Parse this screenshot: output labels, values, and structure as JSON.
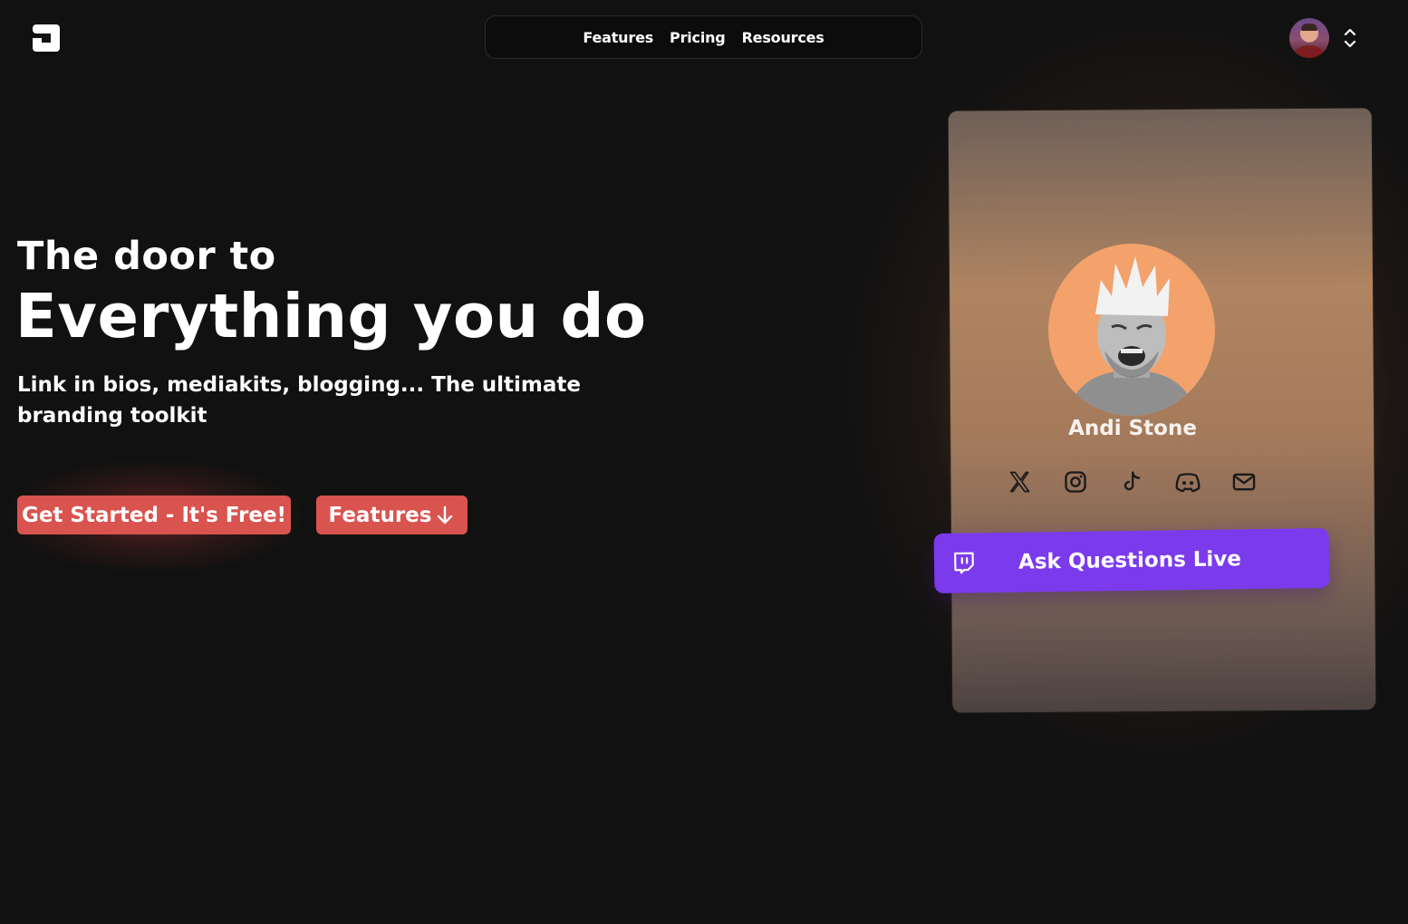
{
  "header": {
    "logo_icon": "brand-logo-icon",
    "nav": [
      {
        "label": "Features"
      },
      {
        "label": "Pricing"
      },
      {
        "label": "Resources"
      }
    ],
    "account_icon": "user-avatar",
    "switcher_icon": "chevrons-up-down-icon"
  },
  "hero": {
    "pre_title": "The door to",
    "title": "Everything you do",
    "subtitle": "Link in bios, mediakits, blogging... The ultimate branding toolkit",
    "cta_primary": "Get Started - It's Free!",
    "cta_secondary": "Features",
    "cta_secondary_icon": "arrow-down-icon"
  },
  "profile_card": {
    "name": "Andi Stone",
    "social_icons": [
      "x-icon",
      "instagram-icon",
      "tiktok-icon",
      "discord-icon",
      "mail-icon"
    ],
    "live_button_label": "Ask Questions Live",
    "live_button_icon": "twitch-icon"
  },
  "colors": {
    "background": "#111111",
    "cta": "#d9534f",
    "live_button": "#7c3aed",
    "card_glow": "#ec8c46",
    "photo_background": "#f3a26c"
  }
}
